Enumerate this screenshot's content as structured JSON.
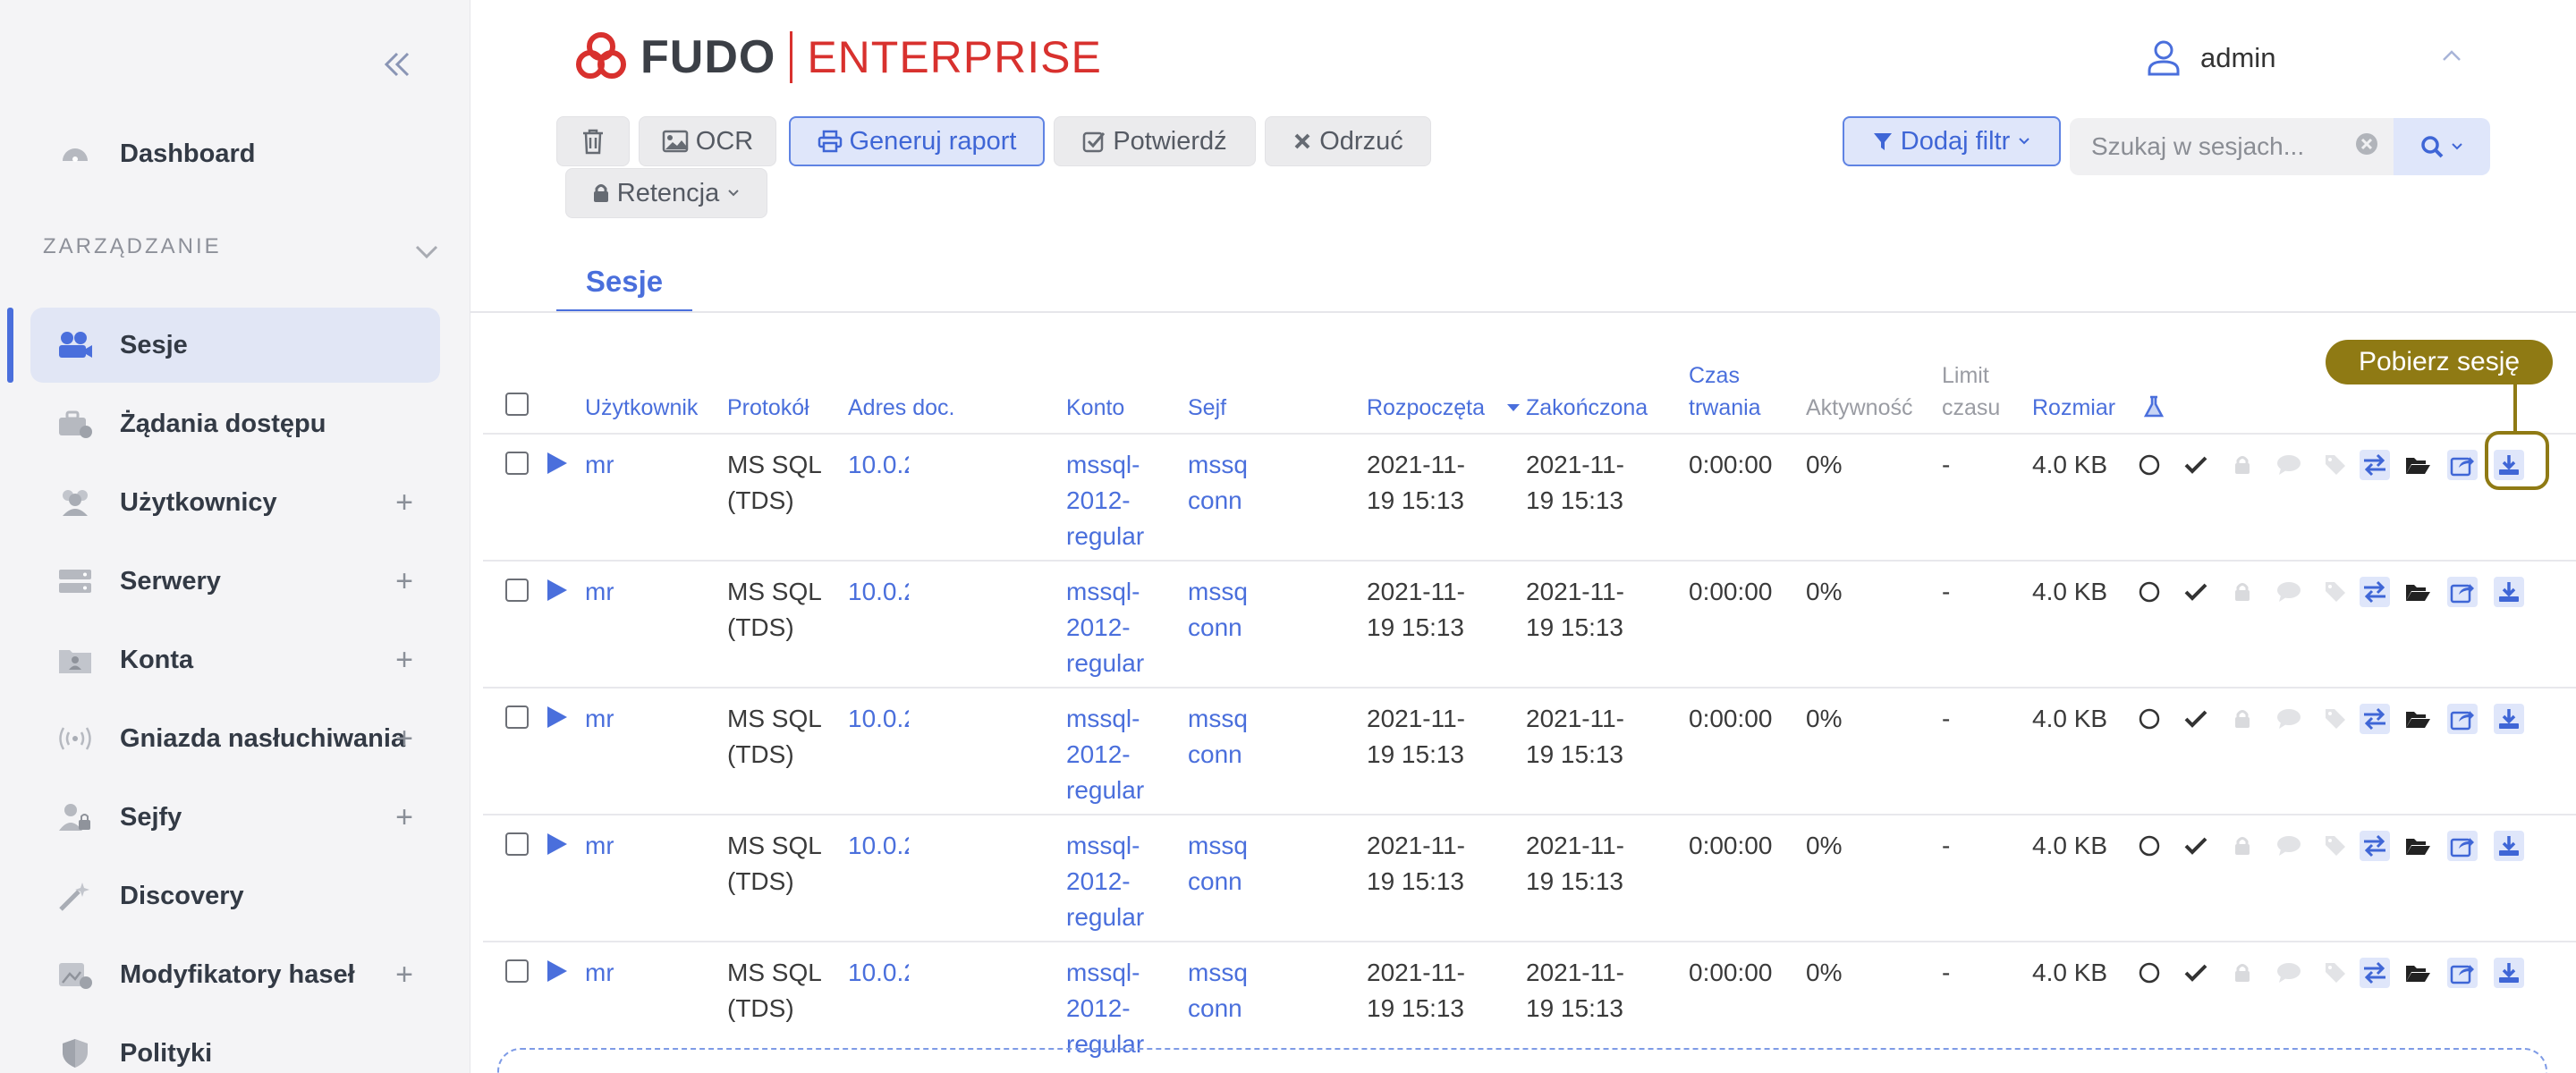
{
  "sidebar": {
    "collapse_icon": "double-chevron-left-icon",
    "dashboard_label": "Dashboard",
    "section_label": "ZARZĄDZANIE",
    "items": [
      {
        "label": "Sesje",
        "icon": "sessions-icon",
        "plus": ""
      },
      {
        "label": "Żądania dostępu",
        "icon": "access-requests-icon",
        "plus": ""
      },
      {
        "label": "Użytkownicy",
        "icon": "users-icon",
        "plus": "+"
      },
      {
        "label": "Serwery",
        "icon": "servers-icon",
        "plus": "+"
      },
      {
        "label": "Konta",
        "icon": "accounts-icon",
        "plus": "+"
      },
      {
        "label": "Gniazda nasłuchiwania",
        "icon": "listeners-icon",
        "plus": "+"
      },
      {
        "label": "Sejfy",
        "icon": "safes-icon",
        "plus": "+"
      },
      {
        "label": "Discovery",
        "icon": "discovery-icon",
        "plus": ""
      },
      {
        "label": "Modyfikatory haseł",
        "icon": "password-changers-icon",
        "plus": "+"
      },
      {
        "label": "Polityki",
        "icon": "policies-icon",
        "plus": ""
      }
    ]
  },
  "header": {
    "logo_fudo": "FUDO",
    "logo_enterprise": "ENTERPRISE",
    "user": "admin"
  },
  "toolbar": {
    "ocr": "OCR",
    "report": "Generuj raport",
    "confirm": "Potwierdź",
    "reject": "Odrzuć",
    "retention": "Retencja",
    "filter": "Dodaj filtr",
    "search_placeholder": "Szukaj w sesjach..."
  },
  "tabs": {
    "sessions": "Sesje"
  },
  "table": {
    "headers": {
      "user": "Użytkownik",
      "protocol": "Protokół",
      "address": "Adres doc.",
      "account": "Konto",
      "safe": "Sejf",
      "started": "Rozpoczęta",
      "ended": "Zakończona",
      "duration_1": "Czas",
      "duration_2": "trwania",
      "activity": "Aktywność",
      "limit_1": "Limit",
      "limit_2": "czasu",
      "size": "Rozmiar"
    },
    "rows": [
      {
        "user": "mr",
        "protocol_1": "MS SQL",
        "protocol_2": "(TDS)",
        "address": "10.0.2",
        "account_1": "mssql-",
        "account_2": "2012-",
        "account_3": "regular",
        "safe_1": "mssq",
        "safe_2": "conn",
        "started_1": "2021-11-",
        "started_2": "19 15:13",
        "ended_1": "2021-11-",
        "ended_2": "19 15:13",
        "duration": "0:00:00",
        "activity": "0%",
        "limit": "-",
        "size": "4.0 KB"
      },
      {
        "user": "mr",
        "protocol_1": "MS SQL",
        "protocol_2": "(TDS)",
        "address": "10.0.2",
        "account_1": "mssql-",
        "account_2": "2012-",
        "account_3": "regular",
        "safe_1": "mssq",
        "safe_2": "conn",
        "started_1": "2021-11-",
        "started_2": "19 15:13",
        "ended_1": "2021-11-",
        "ended_2": "19 15:13",
        "duration": "0:00:00",
        "activity": "0%",
        "limit": "-",
        "size": "4.0 KB"
      },
      {
        "user": "mr",
        "protocol_1": "MS SQL",
        "protocol_2": "(TDS)",
        "address": "10.0.2",
        "account_1": "mssql-",
        "account_2": "2012-",
        "account_3": "regular",
        "safe_1": "mssq",
        "safe_2": "conn",
        "started_1": "2021-11-",
        "started_2": "19 15:13",
        "ended_1": "2021-11-",
        "ended_2": "19 15:13",
        "duration": "0:00:00",
        "activity": "0%",
        "limit": "-",
        "size": "4.0 KB"
      },
      {
        "user": "mr",
        "protocol_1": "MS SQL",
        "protocol_2": "(TDS)",
        "address": "10.0.2",
        "account_1": "mssql-",
        "account_2": "2012-",
        "account_3": "regular",
        "safe_1": "mssq",
        "safe_2": "conn",
        "started_1": "2021-11-",
        "started_2": "19 15:13",
        "ended_1": "2021-11-",
        "ended_2": "19 15:13",
        "duration": "0:00:00",
        "activity": "0%",
        "limit": "-",
        "size": "4.0 KB"
      },
      {
        "user": "mr",
        "protocol_1": "MS SQL",
        "protocol_2": "(TDS)",
        "address": "10.0.2",
        "account_1": "mssql-",
        "account_2": "2012-",
        "account_3": "regular",
        "safe_1": "mssq",
        "safe_2": "conn",
        "started_1": "2021-11-",
        "started_2": "19 15:13",
        "ended_1": "2021-11-",
        "ended_2": "19 15:13",
        "duration": "0:00:00",
        "activity": "0%",
        "limit": "-",
        "size": "4.0 KB"
      }
    ],
    "row_action_icons": [
      "circle-status-icon",
      "check-icon",
      "lock-icon",
      "comment-icon",
      "tag-icon",
      "exchange-icon",
      "folder-icon",
      "share-icon",
      "download-icon"
    ]
  },
  "tooltip": {
    "text": "Pobierz sesję"
  },
  "colors": {
    "accent": "#4a6fdc",
    "brand_red": "#d8312e",
    "highlight": "#8f7a14",
    "sidebar_bg": "#f4f4f6"
  }
}
